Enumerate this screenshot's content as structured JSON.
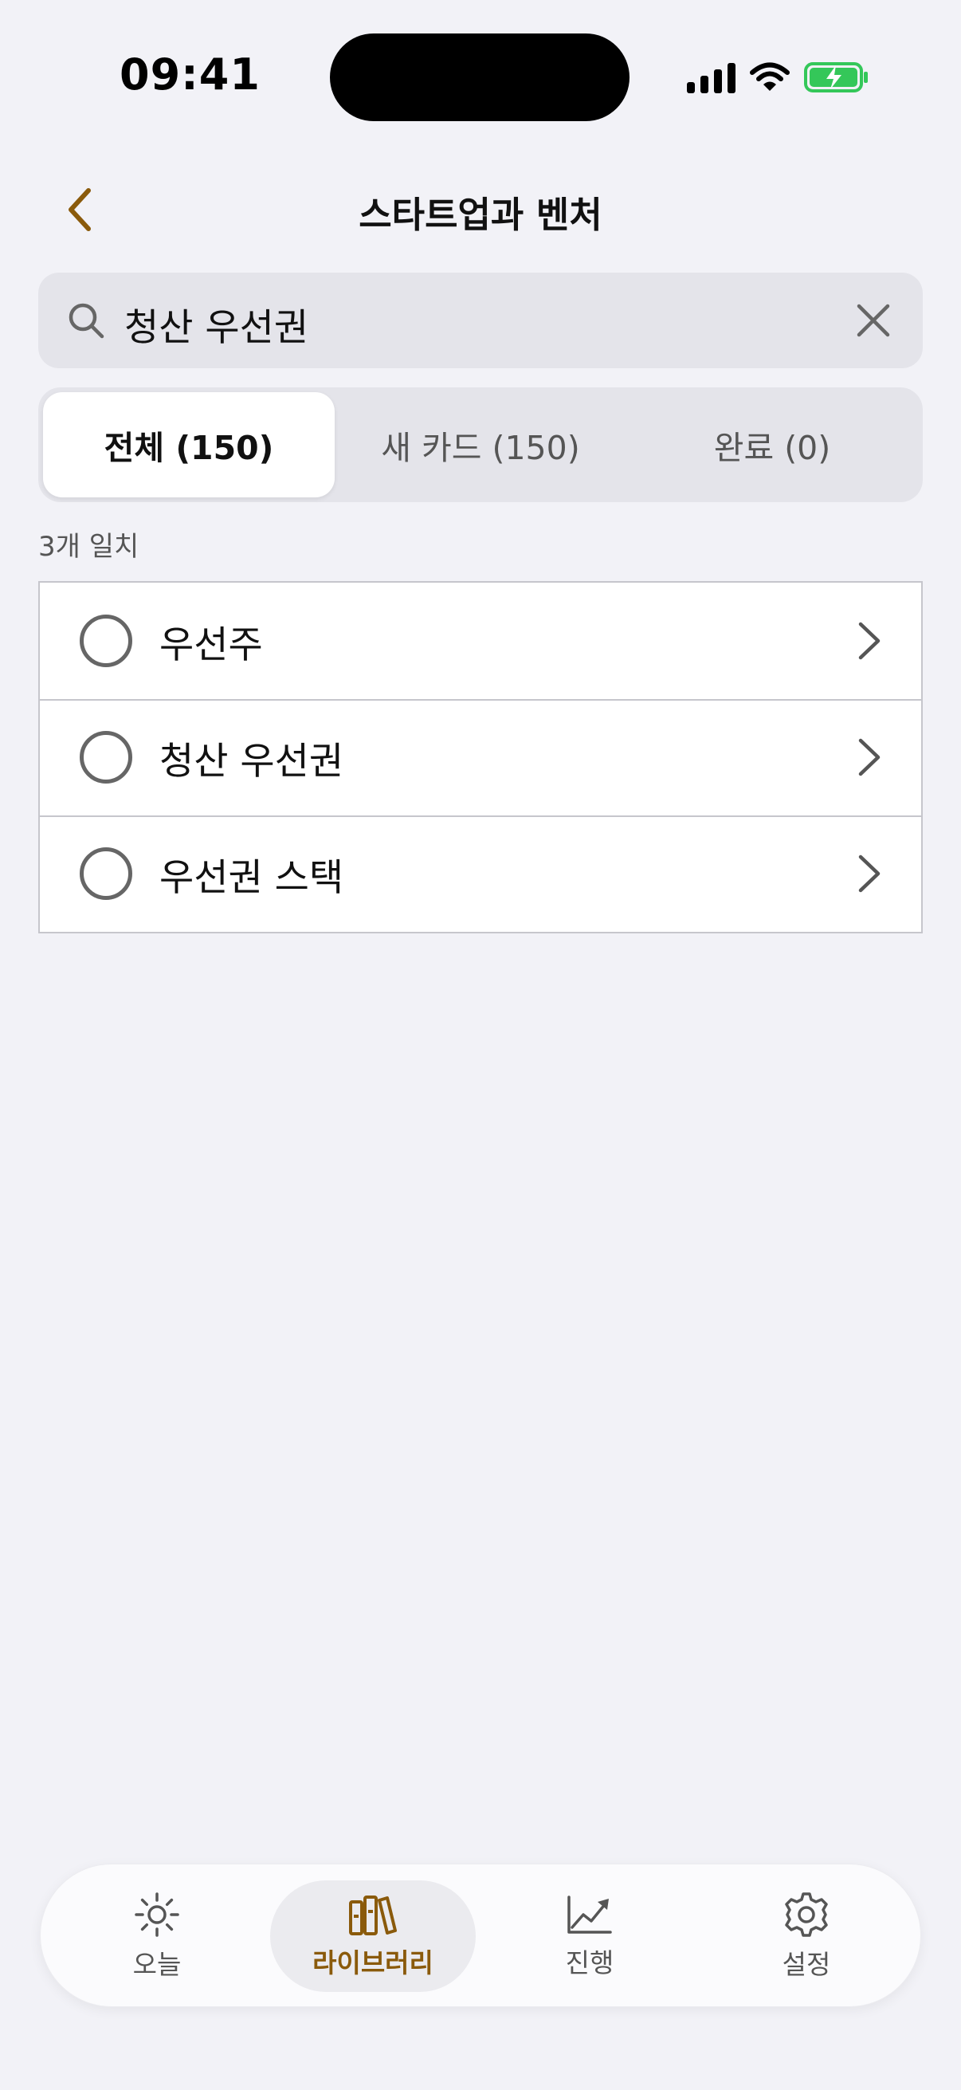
{
  "status": {
    "time": "09:41"
  },
  "nav": {
    "title": "스타트업과 벤처"
  },
  "search": {
    "value": "청산 우선권"
  },
  "segments": [
    {
      "label": "전체 (150)",
      "active": true
    },
    {
      "label": "새 카드 (150)",
      "active": false
    },
    {
      "label": "완료 (0)",
      "active": false
    }
  ],
  "results": {
    "count_text": "3개 일치"
  },
  "items": [
    {
      "label": "우선주"
    },
    {
      "label": "청산 우선권"
    },
    {
      "label": "우선권 스택"
    }
  ],
  "tabbar": {
    "tabs": [
      {
        "label": "오늘",
        "icon": "sun-icon",
        "active": false
      },
      {
        "label": "라이브러리",
        "icon": "library-icon",
        "active": true
      },
      {
        "label": "진행",
        "icon": "chart-line-icon",
        "active": false
      },
      {
        "label": "설정",
        "icon": "gear-icon",
        "active": false
      }
    ]
  },
  "colors": {
    "accent": "#8a5a0b",
    "battery": "#34c759",
    "background": "#f2f2f7"
  }
}
